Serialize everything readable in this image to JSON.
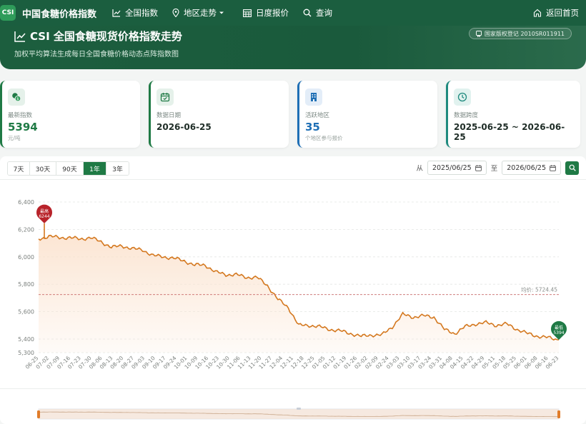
{
  "nav": {
    "logo": "CSI",
    "brand": "中国食糖价格指数",
    "items": [
      "全国指数",
      "地区走势",
      "日度报价",
      "查询"
    ],
    "back": "返回首页"
  },
  "hero": {
    "title": "CSI 全国食糖现货价格指数走势",
    "subtitle": "加权平均算法生成每日全国食糖价格动态点阵指数图",
    "copyright": "国家版权登记 2010SR011911"
  },
  "cards": [
    {
      "label": "最新指数",
      "value": "5394",
      "unit": "元/吨",
      "color": "#1f7a45"
    },
    {
      "label": "数据日期",
      "value": "2026-06-25",
      "unit": "",
      "color": "#1f7a45"
    },
    {
      "label": "活跃地区",
      "value": "35",
      "unit": "个地区参与报价",
      "color": "#1f6fb5"
    },
    {
      "label": "数据跨度",
      "value": "2025-06-25 ~ 2026-06-25",
      "unit": "",
      "color": "#1f8a7e"
    }
  ],
  "controls": {
    "ranges": [
      "7天",
      "30天",
      "90天",
      "1年",
      "3年"
    ],
    "active_range": "1年",
    "from_label": "从",
    "to_label": "至",
    "from_date": "2025/06/25",
    "to_date": "2026/06/25"
  },
  "chart_data": {
    "type": "area",
    "title": "",
    "xlabel": "",
    "ylabel": "",
    "ylim": [
      5300,
      6400
    ],
    "yticks": [
      5300,
      5400,
      5600,
      5800,
      6000,
      6200,
      6400
    ],
    "xticks": [
      "06-25",
      "07-02",
      "07-09",
      "07-16",
      "07-23",
      "07-30",
      "08-06",
      "08-13",
      "08-20",
      "08-27",
      "09-03",
      "09-10",
      "09-17",
      "09-24",
      "10-01",
      "10-09",
      "10-16",
      "10-23",
      "10-30",
      "11-06",
      "11-13",
      "11-20",
      "11-27",
      "12-04",
      "12-11",
      "12-18",
      "12-25",
      "01-05",
      "01-12",
      "01-19",
      "01-26",
      "02-02",
      "02-09",
      "02-24",
      "03-03",
      "03-10",
      "03-17",
      "03-24",
      "03-31",
      "04-08",
      "04-15",
      "04-22",
      "04-29",
      "05-11",
      "05-18",
      "05-25",
      "06-01",
      "06-08",
      "06-16",
      "06-23"
    ],
    "x": [
      "06-25",
      "07-02",
      "07-09",
      "07-16",
      "07-23",
      "07-30",
      "08-06",
      "08-13",
      "08-20",
      "08-27",
      "09-03",
      "09-10",
      "09-17",
      "09-24",
      "10-01",
      "10-09",
      "10-16",
      "10-23",
      "10-30",
      "11-06",
      "11-13",
      "11-20",
      "11-27",
      "12-04",
      "12-11",
      "12-18",
      "12-25",
      "01-05",
      "01-12",
      "01-19",
      "01-26",
      "02-02",
      "02-09",
      "02-24",
      "03-03",
      "03-10",
      "03-17",
      "03-24",
      "03-31",
      "04-08",
      "04-15",
      "04-22",
      "04-29",
      "05-11",
      "05-18",
      "05-25",
      "06-01",
      "06-08",
      "06-16",
      "06-23",
      "06-25"
    ],
    "values": [
      6130,
      6150,
      6140,
      6140,
      6130,
      6140,
      6110,
      6070,
      6080,
      6060,
      6050,
      6010,
      6000,
      5990,
      5970,
      5940,
      5940,
      5890,
      5870,
      5870,
      5850,
      5850,
      5790,
      5690,
      5630,
      5500,
      5500,
      5490,
      5470,
      5460,
      5440,
      5420,
      5430,
      5430,
      5490,
      5580,
      5560,
      5570,
      5560,
      5470,
      5440,
      5490,
      5510,
      5520,
      5500,
      5510,
      5470,
      5440,
      5420,
      5410,
      5394
    ],
    "average": 5724.45,
    "average_label": "均价: 5724.45",
    "max": {
      "label": "最高",
      "value": 6244,
      "x": "07-02"
    },
    "min": {
      "label": "最低",
      "value": 5394,
      "x": "06-25"
    },
    "grid": true,
    "legend": "none",
    "line_color": "#d4781f",
    "fill_color": "#fbe3cf"
  }
}
